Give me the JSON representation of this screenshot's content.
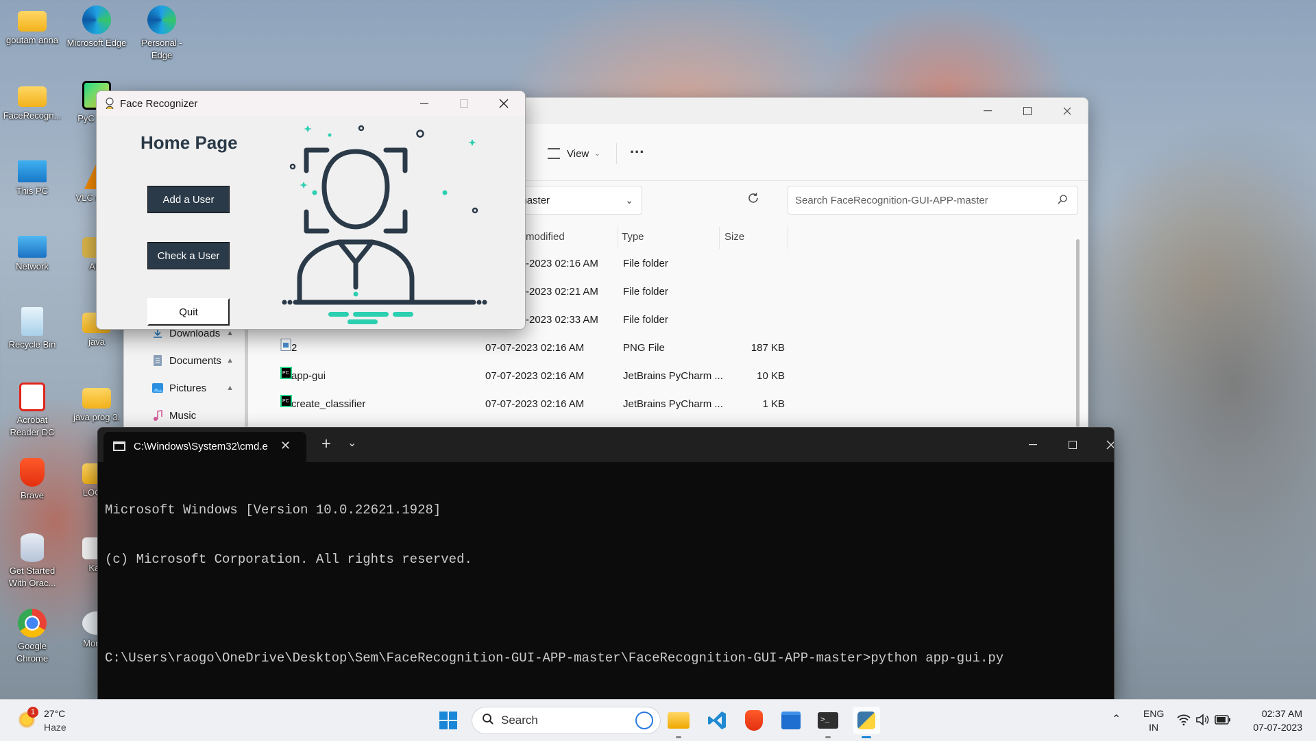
{
  "desktop": {
    "icons": [
      {
        "label": "goutam anna"
      },
      {
        "label": "Microsoft Edge"
      },
      {
        "label": "Personal - Edge"
      },
      {
        "label": "FaceRecogn..."
      },
      {
        "label": "PyC Com"
      },
      {
        "label": "This PC"
      },
      {
        "label": "VLC m pla"
      },
      {
        "label": "Network"
      },
      {
        "label": "ANI"
      },
      {
        "label": "Recycle Bin"
      },
      {
        "label": "java"
      },
      {
        "label": "Acrobat Reader DC"
      },
      {
        "label": "java prog 3."
      },
      {
        "label": "Brave"
      },
      {
        "label": "LOGIN"
      },
      {
        "label": "Get Started With Orac..."
      },
      {
        "label": "Kan"
      },
      {
        "label": "Google Chrome"
      },
      {
        "label": "Mongo"
      }
    ]
  },
  "explorer": {
    "view_label": "View",
    "more_label": "...",
    "address_text": "ognition-GUI-APP-master",
    "search_placeholder": "Search FaceRecognition-GUI-APP-master",
    "nav_items": [
      {
        "label": "Downloads"
      },
      {
        "label": "Documents"
      },
      {
        "label": "Pictures"
      },
      {
        "label": "Music"
      }
    ],
    "columns": {
      "modified": "modified",
      "type": "Type",
      "size": "Size"
    },
    "rows": [
      {
        "name": "",
        "modified": "-2023 02:16 AM",
        "type": "File folder",
        "size": ""
      },
      {
        "name": "",
        "modified": "-2023 02:21 AM",
        "type": "File folder",
        "size": ""
      },
      {
        "name": "",
        "modified": "-2023 02:33 AM",
        "type": "File folder",
        "size": ""
      },
      {
        "name": "2",
        "modified": "07-07-2023 02:16 AM",
        "type": "PNG File",
        "size": "187 KB"
      },
      {
        "name": "app-gui",
        "modified": "07-07-2023 02:16 AM",
        "type": "JetBrains PyCharm ...",
        "size": "10 KB"
      },
      {
        "name": "create_classifier",
        "modified": "07-07-2023 02:16 AM",
        "type": "JetBrains PyCharm ...",
        "size": "1 KB"
      }
    ]
  },
  "face_app": {
    "title": "Face Recognizer",
    "heading": "Home Page",
    "add_user_label": "Add a User",
    "check_user_label": "Check a User",
    "quit_label": "Quit",
    "colors": {
      "dark": "#2b3a48",
      "accent": "#2ccfb0"
    }
  },
  "terminal": {
    "tab_title": "C:\\Windows\\System32\\cmd.e",
    "lines": [
      "Microsoft Windows [Version 10.0.22621.1928]",
      "(c) Microsoft Corporation. All rights reserved.",
      "",
      "C:\\Users\\raogo\\OneDrive\\Desktop\\Sem\\FaceRecognition-GUI-APP-master\\FaceRecognition-GUI-APP-master>python app-gui.py"
    ]
  },
  "taskbar": {
    "weather_temp": "27°C",
    "weather_desc": "Haze",
    "weather_badge": "1",
    "search_label": "Search",
    "lang_top": "ENG",
    "lang_bottom": "IN",
    "time": "02:37 AM",
    "date": "07-07-2023"
  }
}
